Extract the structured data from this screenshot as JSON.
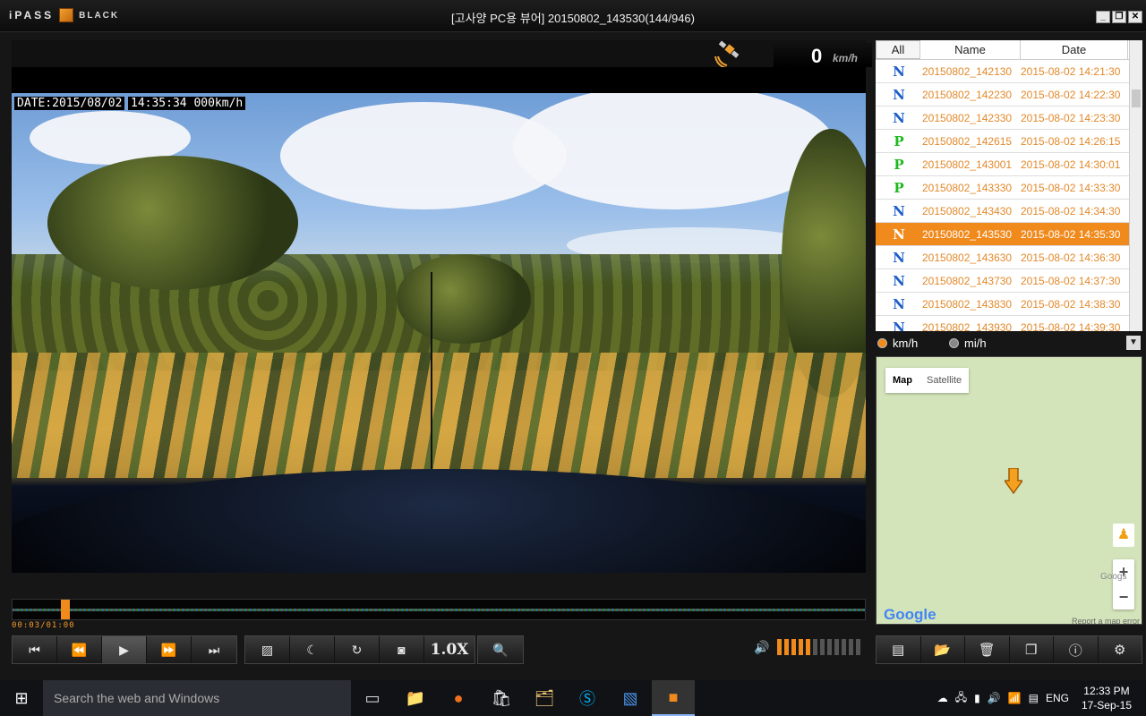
{
  "app": {
    "logo_text": "iPASS",
    "logo_sub": "BLACK",
    "title": "[고사양 PC용 뷰어]   20150802_143530(144/946)"
  },
  "video": {
    "speed_value": "0",
    "speed_unit": "km/h",
    "overlay_date": "DATE:2015/08/02",
    "overlay_time": "14:35:34 000km/h",
    "timecode": "00:03/01:00",
    "progress_fraction": 0.05
  },
  "controls": {
    "playback": [
      "skip-back",
      "rewind",
      "play",
      "fast-forward",
      "skip-forward"
    ],
    "tools": [
      "image-adjust",
      "night-mode",
      "rotate",
      "snapshot"
    ],
    "speed_label": "1.0X",
    "volume_level": 5,
    "volume_max": 12
  },
  "file_list": {
    "headers": {
      "all": "All",
      "name": "Name",
      "date": "Date"
    },
    "selected_index": 7,
    "rows": [
      {
        "type": "N",
        "name": "20150802_142130",
        "date": "2015-08-02 14:21:30"
      },
      {
        "type": "N",
        "name": "20150802_142230",
        "date": "2015-08-02 14:22:30"
      },
      {
        "type": "N",
        "name": "20150802_142330",
        "date": "2015-08-02 14:23:30"
      },
      {
        "type": "P",
        "name": "20150802_142615",
        "date": "2015-08-02 14:26:15"
      },
      {
        "type": "P",
        "name": "20150802_143001",
        "date": "2015-08-02 14:30:01"
      },
      {
        "type": "P",
        "name": "20150802_143330",
        "date": "2015-08-02 14:33:30"
      },
      {
        "type": "N",
        "name": "20150802_143430",
        "date": "2015-08-02 14:34:30"
      },
      {
        "type": "N",
        "name": "20150802_143530",
        "date": "2015-08-02 14:35:30"
      },
      {
        "type": "N",
        "name": "20150802_143630",
        "date": "2015-08-02 14:36:30"
      },
      {
        "type": "N",
        "name": "20150802_143730",
        "date": "2015-08-02 14:37:30"
      },
      {
        "type": "N",
        "name": "20150802_143830",
        "date": "2015-08-02 14:38:30"
      },
      {
        "type": "N",
        "name": "20150802_143930",
        "date": "2015-08-02 14:39:30"
      }
    ]
  },
  "units": {
    "kmh": "km/h",
    "mph": "mi/h",
    "selected": "km/h"
  },
  "map": {
    "tab_map": "Map",
    "tab_satellite": "Satellite",
    "zoom_in": "+",
    "zoom_out": "−",
    "brand": "Google",
    "watermark": "Googs",
    "report": "Report a map error"
  },
  "right_tools": [
    "sd-card",
    "folder",
    "delete",
    "copy",
    "info",
    "settings"
  ],
  "taskbar": {
    "search_placeholder": "Search the web and Windows",
    "language": "ENG",
    "time": "12:33 PM",
    "date": "17-Sep-15"
  },
  "colors": {
    "accent": "#f08a1c",
    "normal_type": "#1d5ec8",
    "parking_type": "#1fb81f"
  }
}
